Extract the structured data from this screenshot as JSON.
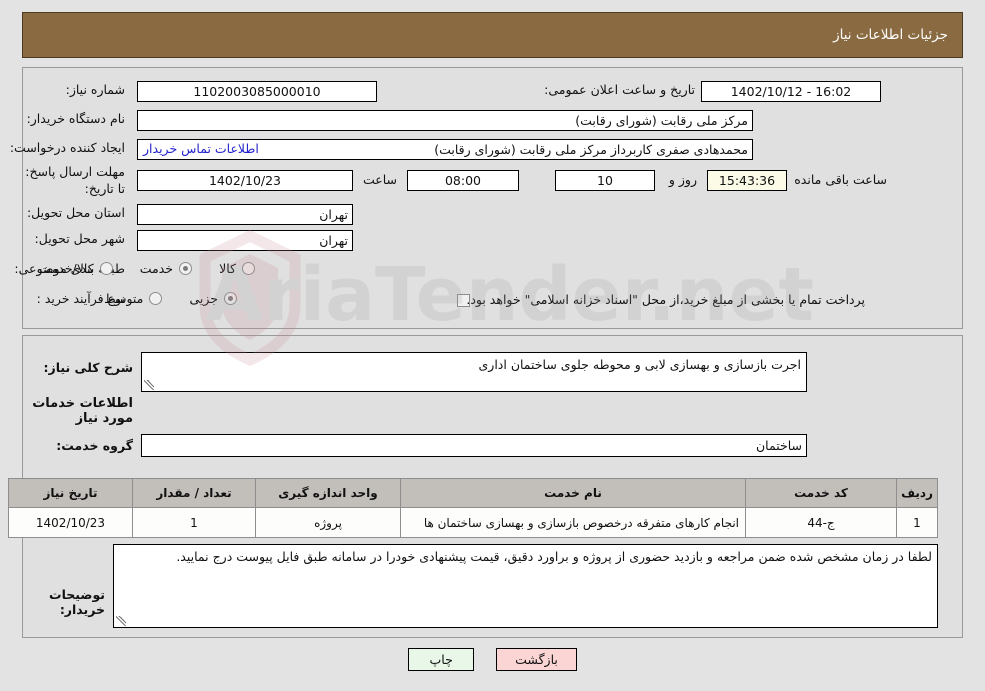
{
  "header": {
    "title": "جزئیات اطلاعات نیاز"
  },
  "top_panel": {
    "need_number_label": "شماره نیاز:",
    "need_number_value": "1102003085000010",
    "public_announce_label": "تاریخ و ساعت اعلان عمومی:",
    "public_announce_value": "16:02 - 1402/10/12",
    "buyer_org_label": "نام دستگاه خریدار:",
    "buyer_org_value": "مرکز ملی رقابت (شورای رقابت)",
    "requester_label": "ایجاد کننده درخواست:",
    "requester_value": "محمدهادی صفری کاربرداز مرکز ملی رقابت (شورای رقابت)",
    "buyer_contact_link": "اطلاعات تماس خریدار",
    "deadline_label": "مهلت ارسال پاسخ: تا تاریخ:",
    "deadline_date": "1402/10/23",
    "time_label": "ساعت",
    "deadline_time": "08:00",
    "days_remaining": "10",
    "days_unit": "روز و",
    "time_remaining": "15:43:36",
    "remaining_suffix": "ساعت باقی مانده",
    "province_label": "استان محل تحویل:",
    "province_value": "تهران",
    "city_label": "شهر محل تحویل:",
    "city_value": "تهران",
    "category_label": "طبقه بندی موضوعی:",
    "category_options": [
      {
        "label": "کالا",
        "selected": false
      },
      {
        "label": "خدمت",
        "selected": true
      },
      {
        "label": "کالا/خدمت",
        "selected": false
      }
    ],
    "process_label": "نوع فرآیند خرید :",
    "process_options": [
      {
        "label": "جزیی",
        "selected": true
      },
      {
        "label": "متوسط",
        "selected": false
      }
    ],
    "treasury_checkbox_checked": false,
    "treasury_text": "پرداخت تمام یا بخشی از مبلغ خرید،از محل \"اسناد خزانه اسلامی\" خواهد بود."
  },
  "mid_panel": {
    "general_desc_label": "شرح کلی نیاز:",
    "general_desc_value": "اجرت بازسازی و بهسازی لابی و محوطه جلوی ساختمان اداری",
    "services_heading": "اطلاعات خدمات مورد نیاز",
    "service_group_label": "گروه خدمت:",
    "service_group_value": "ساختمان",
    "table": {
      "headers": [
        "ردیف",
        "کد خدمت",
        "نام خدمت",
        "واحد اندازه گیری",
        "تعداد / مقدار",
        "تاریخ نیاز"
      ],
      "rows": [
        [
          "1",
          "ج-44",
          "انجام کارهای متفرقه درخصوص بازسازی و بهسازی ساختمان ها",
          "پروژه",
          "1",
          "1402/10/23"
        ]
      ]
    },
    "buyer_notes_label": "توضیحات خریدار:",
    "buyer_notes_value": "لطفا در زمان مشخص شده ضمن مراجعه و بازدید حضوری از پروژه و براورد دقیق، قیمت پیشنهادی خودرا در سامانه طبق فایل پیوست درج نمایید."
  },
  "buttons": {
    "print": "چاپ",
    "back": "بازگشت"
  },
  "watermark": {
    "text": "AriaTender.net"
  },
  "colors": {
    "header_bg": "#8a6a40",
    "panel_bg": "#e0e0e0",
    "page_bg": "#e3e3e3",
    "link": "#2222cc",
    "table_header_bg": "#c2bfbb",
    "print_button_bg": "#e9f7e9",
    "back_button_bg": "#fbd4d4",
    "countdown_bg": "#fbfbe8"
  }
}
